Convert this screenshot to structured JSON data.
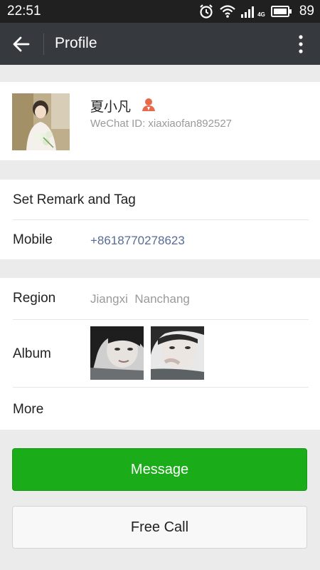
{
  "status_bar": {
    "time": "22:51",
    "network_label": "4G",
    "battery_level": "89",
    "icons": [
      "alarm-icon",
      "wifi-icon",
      "signal-icon",
      "battery-icon"
    ]
  },
  "action_bar": {
    "title": "Profile",
    "back_icon": "back-arrow-icon",
    "menu_icon": "more-vertical-icon"
  },
  "profile": {
    "name": "夏小凡",
    "wechat_id": "WeChat ID: xiaxiaofan892527",
    "gender_icon": "user-icon"
  },
  "details": {
    "remark_label": "Set Remark and Tag",
    "mobile_label": "Mobile",
    "mobile_value": "+8618770278623",
    "region_label": "Region",
    "region_value": "Jiangxi  Nanchang",
    "album_label": "Album",
    "more_label": "More"
  },
  "buttons": {
    "message": "Message",
    "free_call": "Free Call"
  },
  "colors": {
    "accent_green": "#1aad19",
    "link_blue": "#576b95",
    "action_bar": "#36393d",
    "status_bar": "#202020"
  }
}
